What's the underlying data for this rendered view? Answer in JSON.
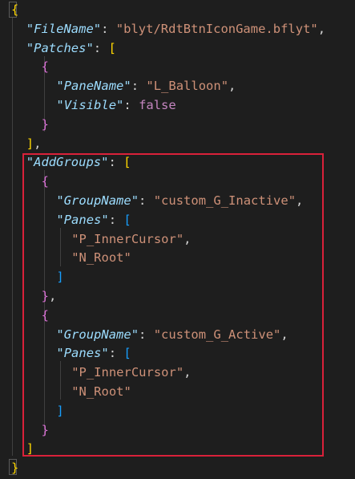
{
  "editor": {
    "lines": [
      {
        "text": "{"
      },
      {
        "key": "\"FileName\"",
        "sep": ": ",
        "value": "\"blyt/RdtBtnIconGame.bflyt\"",
        "trail": ","
      },
      {
        "key": "\"Patches\"",
        "sep": ": ",
        "bracket": "["
      },
      {
        "bracket": "{"
      },
      {
        "key": "\"PaneName\"",
        "sep": ": ",
        "value": "\"L_Balloon\"",
        "trail": ","
      },
      {
        "key": "\"Visible\"",
        "sep": ": ",
        "bool": "false"
      },
      {
        "bracket": "}"
      },
      {
        "bracket": "]",
        "trail": ","
      },
      {
        "key": "\"AddGroups\"",
        "sep": ": ",
        "bracket": "["
      },
      {
        "bracket": "{"
      },
      {
        "key": "\"GroupName\"",
        "sep": ": ",
        "value": "\"custom_G_Inactive\"",
        "trail": ","
      },
      {
        "key": "\"Panes\"",
        "sep": ": ",
        "bracket": "["
      },
      {
        "value": "\"P_InnerCursor\"",
        "trail": ","
      },
      {
        "value": "\"N_Root\""
      },
      {
        "bracket": "]"
      },
      {
        "bracket": "}",
        "trail": ","
      },
      {
        "bracket": "{"
      },
      {
        "key": "\"GroupName\"",
        "sep": ": ",
        "value": "\"custom_G_Active\"",
        "trail": ","
      },
      {
        "key": "\"Panes\"",
        "sep": ": ",
        "bracket": "["
      },
      {
        "value": "\"P_InnerCursor\"",
        "trail": ","
      },
      {
        "value": "\"N_Root\""
      },
      {
        "bracket": "]"
      },
      {
        "bracket": "}"
      },
      {
        "bracket": "]"
      },
      {
        "text": "}"
      }
    ]
  },
  "colors": {
    "background": "#1e1e1e",
    "highlight_box": "#d9213a"
  }
}
